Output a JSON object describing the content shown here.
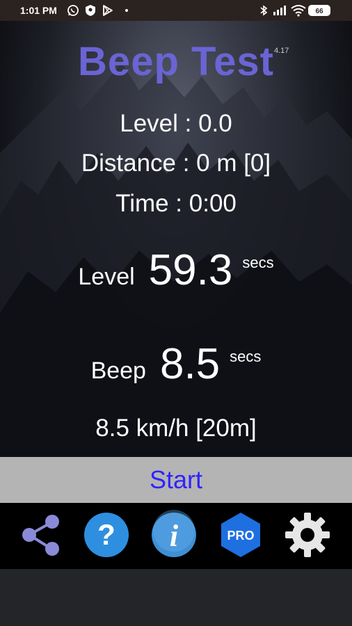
{
  "status_bar": {
    "time": "1:01 PM",
    "battery": "66"
  },
  "app": {
    "title": "Beep Test",
    "version": "4.17"
  },
  "stats": {
    "level": "Level : 0.0",
    "distance": "Distance : 0 m [0]",
    "time": "Time : 0:00"
  },
  "level_timer": {
    "label": "Level",
    "value": "59.3",
    "unit": "secs"
  },
  "beep_timer": {
    "label": "Beep",
    "value": "8.5",
    "unit": "secs"
  },
  "speed": "8.5 km/h [20m]",
  "start_label": "Start",
  "toolbar": {
    "icons": [
      "share-icon",
      "help-icon",
      "info-icon",
      "pro-icon",
      "settings-icon"
    ],
    "pro_label": "PRO"
  },
  "colors": {
    "title": "#6a64d4",
    "start_text": "#2f23ff",
    "start_bg": "#b4b4b4",
    "help_blue": "#2e8fe0",
    "pro_blue": "#1e6fe0"
  }
}
